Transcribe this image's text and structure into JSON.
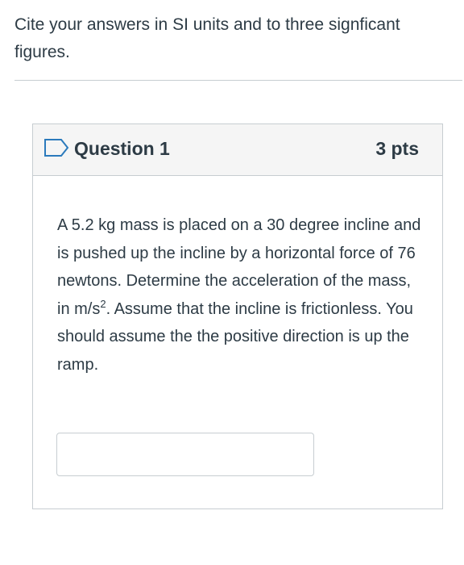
{
  "instructions": {
    "line1": "Cite your answers in SI units and to three signficant",
    "line2": "figures."
  },
  "question": {
    "title": "Question 1",
    "points": "3 pts",
    "text_before_superscript": "A 5.2 kg mass is placed on a 30 degree incline and is pushed up the incline by a horizontal force of 76 newtons.  Determine the acceleration of the mass, in m/s",
    "superscript": "2",
    "text_after_superscript": ". Assume that the incline is frictionless. You should assume the the positive direction is up the ramp.",
    "answer_value": "",
    "flag_icon": "flag-outline-icon"
  },
  "colors": {
    "text": "#2d3b45",
    "border": "#c7cdd1",
    "header_background": "#f5f5f5",
    "flag_stroke": "#2b7abc"
  }
}
